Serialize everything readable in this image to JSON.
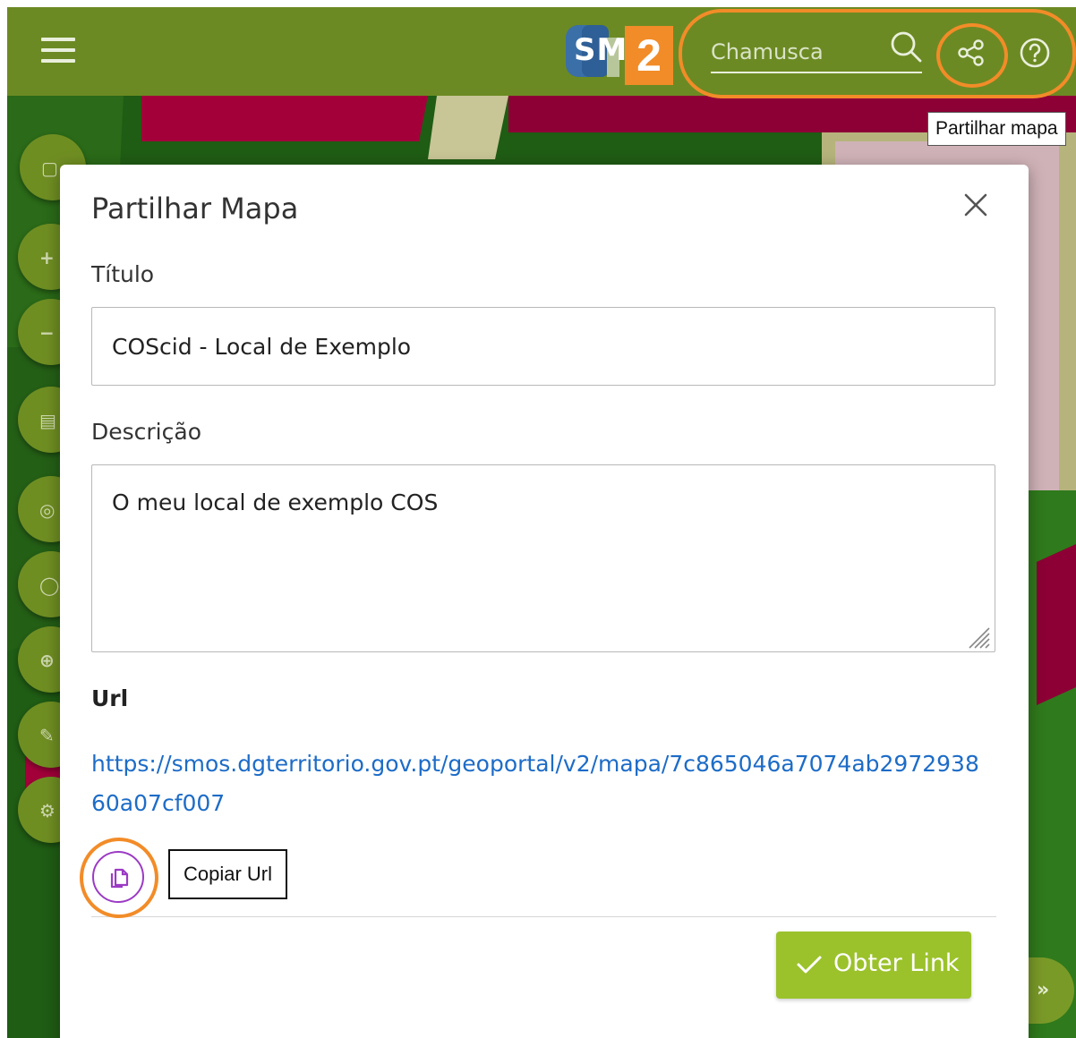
{
  "topbar": {
    "logo_text": "SM",
    "step_number": "2",
    "search_placeholder": "Chamusca",
    "share_tooltip": "Partilhar mapa"
  },
  "dialog": {
    "title": "Partilhar Mapa",
    "title_label": "Título",
    "title_value": "COScid - Local de Exemplo",
    "description_label": "Descrição",
    "description_value": "O meu local de exemplo COS",
    "url_label": "Url",
    "url_value": "https://smos.dgterritorio.gov.pt/geoportal/v2/mapa/7c865046a7074ab297293860a07cf007",
    "copy_tooltip": "Copiar Url",
    "get_link_label": "Obter Link"
  },
  "colors": {
    "topbar": "#6c8a23",
    "accent_orange": "#f28c28",
    "link_blue": "#1d6cc7",
    "primary_button": "#9bc22b",
    "copy_button_purple": "#9b3bc4"
  },
  "icons": [
    "menu-icon",
    "search-icon",
    "share-icon",
    "help-icon",
    "close-icon",
    "copy-icon",
    "check-icon",
    "double-chevron-right-icon"
  ]
}
